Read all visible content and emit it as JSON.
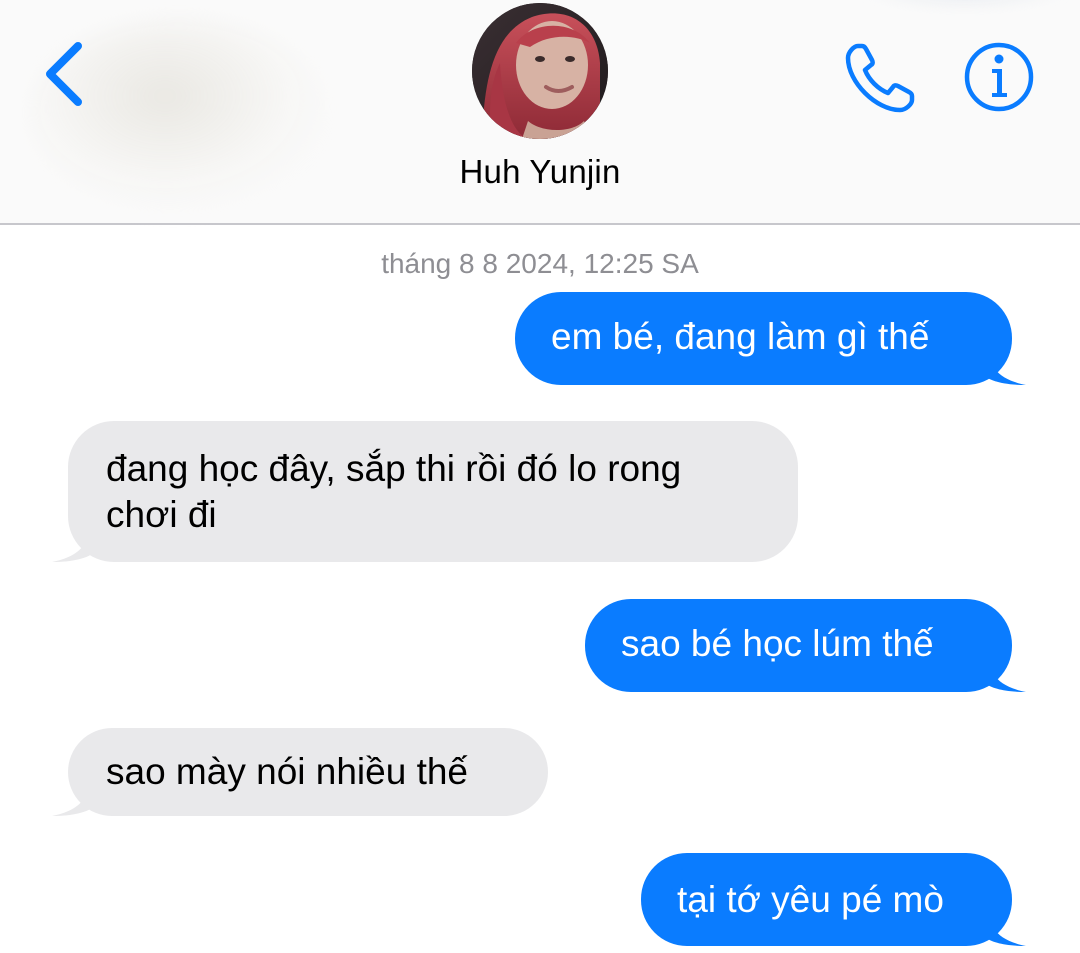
{
  "header": {
    "contact_name": "Huh Yunjin",
    "back_icon": "chevron-left-icon",
    "call_icon": "phone-icon",
    "info_icon": "info-icon",
    "accent_color": "#0a7cff"
  },
  "conversation": {
    "timestamp": "tháng 8 8 2024, 12:25 SA",
    "messages": [
      {
        "direction": "sent",
        "text": "em bé, đang làm gì thế"
      },
      {
        "direction": "received",
        "text": "đang học đây, sắp thi rồi đó lo rong\nchơi đi"
      },
      {
        "direction": "sent",
        "text": "sao bé học lúm thế"
      },
      {
        "direction": "received",
        "text": "sao mày nói nhiều thế"
      },
      {
        "direction": "sent",
        "text": "tại tớ yêu pé mò"
      }
    ]
  },
  "colors": {
    "sent_bubble": "#0a7cff",
    "received_bubble": "#e9e9eb",
    "timestamp_text": "#8e8e93"
  }
}
